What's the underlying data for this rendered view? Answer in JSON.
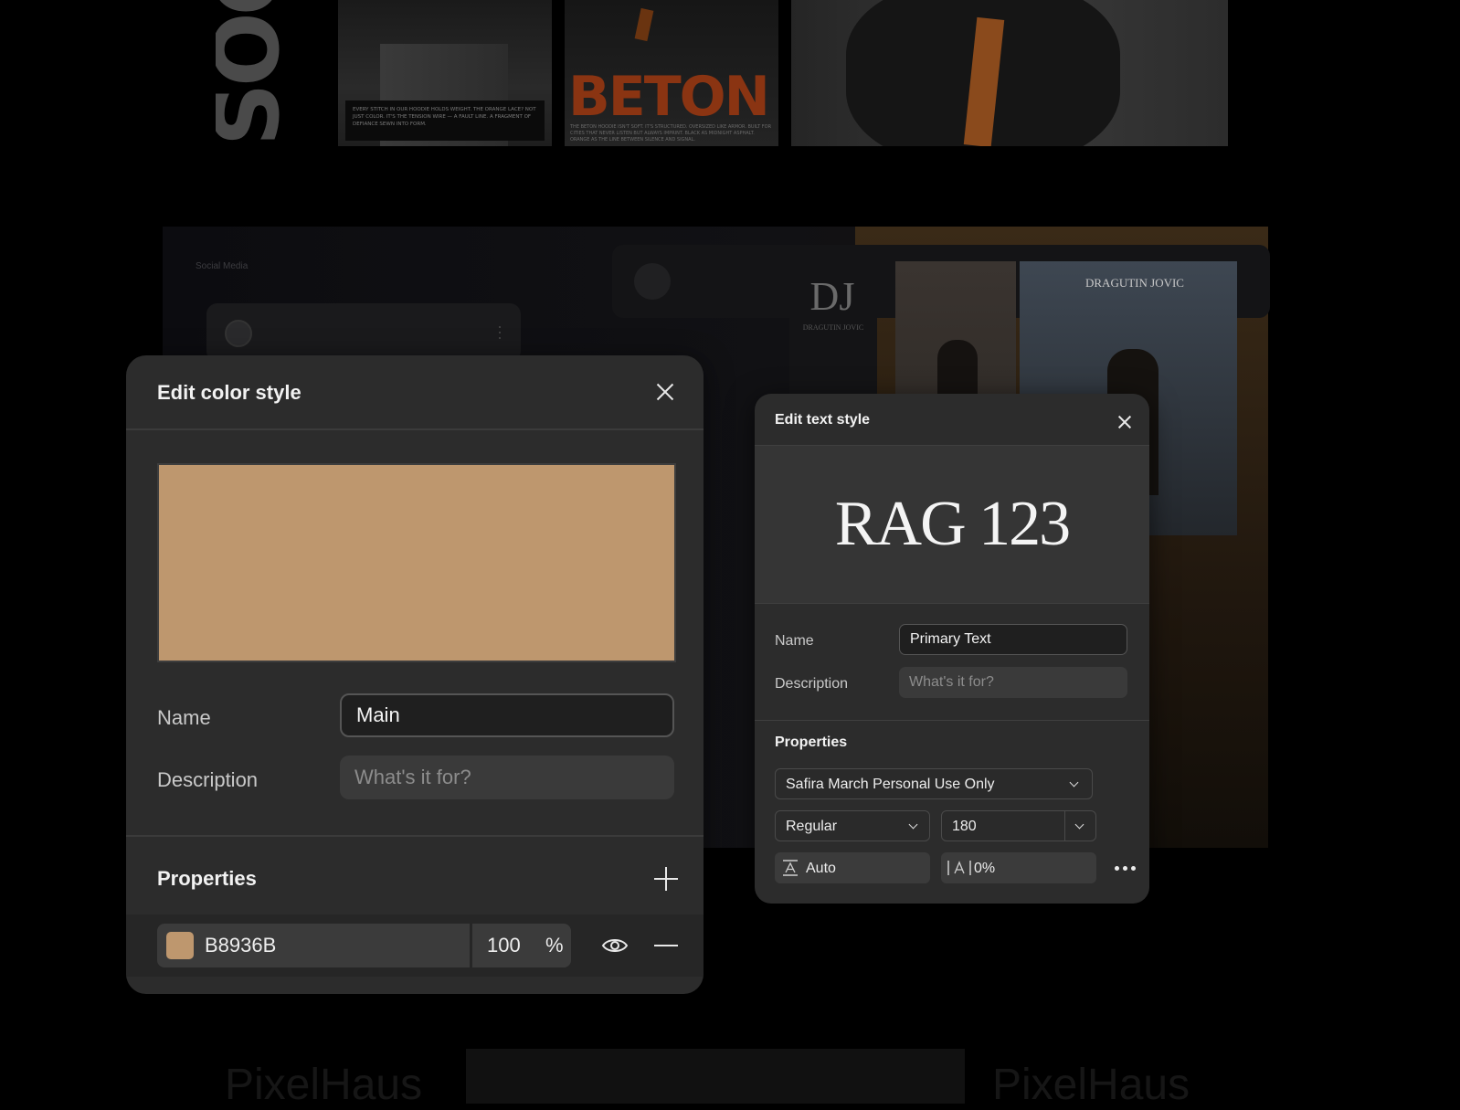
{
  "background": {
    "top_word": "SOC",
    "photo_a_caption": "EVERY STITCH IN OUR HOODIE HOLDS WEIGHT. THE ORANGE LACE? NOT JUST COLOR. IT'S THE TENSION WIRE — A FAULT LINE. A FRAGMENT OF DEFIANCE SEWN INTO FORM.",
    "photo_b_word": "BETON",
    "photo_b_caption": "THE BETON HOODIE ISN'T SOFT. IT'S STRUCTURED. OVERSIZED LIKE ARMOR. BUILT FOR CITIES THAT NEVER LISTEN BUT ALWAYS IMPRINT. BLACK AS MIDNIGHT ASPHALT. ORANGE AS THE LINE BETWEEN SILENCE AND SIGNAL.",
    "panel_label": "Social Media",
    "brand_monogram": "DJ",
    "brand_name": "DRAGUTIN JOVIC",
    "window_brand_name": "DRAGUTIN JOVIC",
    "bottom_word_left": "PixelHaus",
    "bottom_word_right": "PixelHaus"
  },
  "color_dialog": {
    "title": "Edit color style",
    "swatch_color": "#BE976E",
    "name_label": "Name",
    "name_value": "Main",
    "description_label": "Description",
    "description_placeholder": "What's it for?",
    "properties_title": "Properties",
    "fill": {
      "hex": "B8936B",
      "chip_color": "#BE976E",
      "opacity": "100",
      "opacity_unit": "%"
    }
  },
  "text_dialog": {
    "title": "Edit text style",
    "preview_text": "RAG 123",
    "name_label": "Name",
    "name_value": "Primary Text",
    "description_label": "Description",
    "description_placeholder": "What's it for?",
    "properties_title": "Properties",
    "font_family": "Safira March Personal Use Only",
    "font_weight": "Regular",
    "font_size": "180",
    "line_height": "Auto",
    "letter_spacing": "0%"
  }
}
